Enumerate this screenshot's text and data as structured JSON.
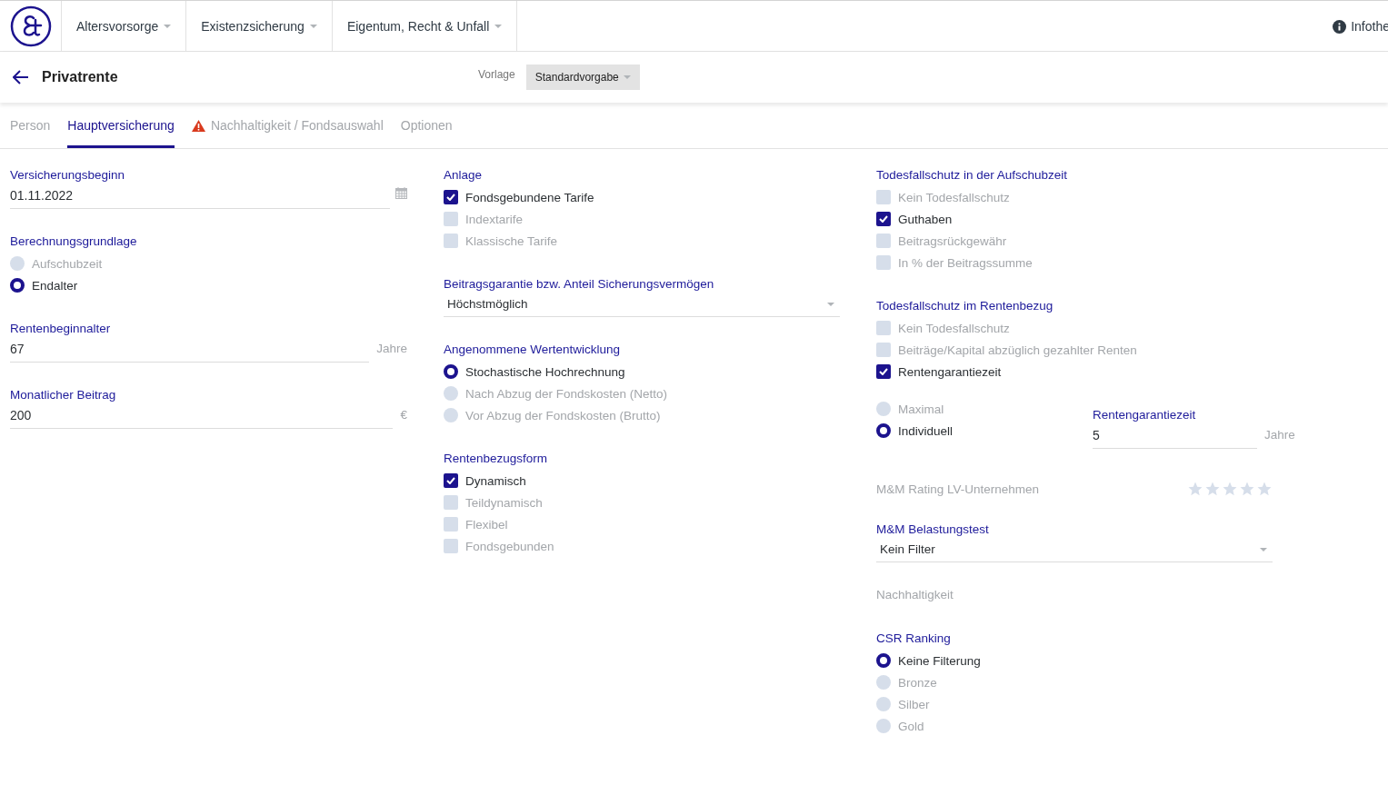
{
  "nav": {
    "items": [
      {
        "label": "Altersvorsorge"
      },
      {
        "label": "Existenzsicherung"
      },
      {
        "label": "Eigentum, Recht & Unfall"
      }
    ],
    "info_link": "Infothe"
  },
  "page_header": {
    "title": "Privatrente",
    "template_label": "Vorlage",
    "template_value": "Standardvorgabe"
  },
  "tabs": [
    {
      "label": "Person",
      "selected": false,
      "warning": false
    },
    {
      "label": "Hauptversicherung",
      "selected": true,
      "warning": false
    },
    {
      "label": "Nachhaltigkeit / Fondsauswahl",
      "selected": false,
      "warning": true
    },
    {
      "label": "Optionen",
      "selected": false,
      "warning": false
    }
  ],
  "columns": [
    {
      "sections": [
        {
          "kind": "date_field",
          "label": "Versicherungsbeginn",
          "value": "01.11.2022"
        },
        {
          "kind": "radio_group",
          "label": "Berechnungsgrundlage",
          "items": [
            {
              "label": "Aufschubzeit",
              "selected": false
            },
            {
              "label": "Endalter",
              "selected": true
            }
          ]
        },
        {
          "kind": "unit_field",
          "label": "Rentenbeginnalter",
          "value": "67",
          "unit": "Jahre"
        },
        {
          "kind": "unit_field",
          "label": "Monatlicher Beitrag",
          "value": "200",
          "unit": "€"
        }
      ]
    },
    {
      "sections": [
        {
          "kind": "checkbox_group",
          "label": "Anlage",
          "items": [
            {
              "label": "Fondsgebundene Tarife",
              "checked": true
            },
            {
              "label": "Indextarife",
              "checked": false
            },
            {
              "label": "Klassische Tarife",
              "checked": false
            }
          ]
        },
        {
          "kind": "select",
          "label": "Beitragsgarantie bzw. Anteil Sicherungsvermögen",
          "value": "Höchstmöglich"
        },
        {
          "kind": "radio_group",
          "label": "Angenommene Wertentwicklung",
          "items": [
            {
              "label": "Stochastische Hochrechnung",
              "selected": true
            },
            {
              "label": "Nach Abzug der Fondskosten (Netto)",
              "selected": false
            },
            {
              "label": "Vor Abzug der Fondskosten (Brutto)",
              "selected": false
            }
          ]
        },
        {
          "kind": "checkbox_group",
          "label": "Rentenbezugsform",
          "items": [
            {
              "label": "Dynamisch",
              "checked": true
            },
            {
              "label": "Teildynamisch",
              "checked": false
            },
            {
              "label": "Flexibel",
              "checked": false
            },
            {
              "label": "Fondsgebunden",
              "checked": false
            }
          ]
        }
      ]
    },
    {
      "sections": [
        {
          "kind": "checkbox_group",
          "label": "Todesfallschutz in der Aufschubzeit",
          "items": [
            {
              "label": "Kein Todesfallschutz",
              "checked": false
            },
            {
              "label": "Guthaben",
              "checked": true
            },
            {
              "label": "Beitragsrückgewähr",
              "checked": false
            },
            {
              "label": "In % der Beitragssumme",
              "checked": false
            }
          ]
        },
        {
          "kind": "checkbox_group",
          "label": "Todesfallschutz im Rentenbezug",
          "items": [
            {
              "label": "Kein Todesfallschutz",
              "checked": false
            },
            {
              "label": "Beiträge/Kapital abzüglich gezahlter Renten",
              "checked": false
            },
            {
              "label": "Rentengarantiezeit",
              "checked": true
            }
          ]
        },
        {
          "kind": "radio_with_field",
          "items": [
            {
              "label": "Maximal",
              "selected": false
            },
            {
              "label": "Individuell",
              "selected": true
            }
          ],
          "field": {
            "label": "Rentengarantiezeit",
            "value": "5",
            "unit": "Jahre"
          }
        },
        {
          "kind": "rating",
          "label": "M&M Rating LV-Unternehmen",
          "stars": 0
        },
        {
          "kind": "select",
          "label": "M&M Belastungstest",
          "value": "Kein Filter"
        },
        {
          "kind": "subheading",
          "label": "Nachhaltigkeit"
        },
        {
          "kind": "radio_group",
          "label": "CSR Ranking",
          "items": [
            {
              "label": "Keine Filterung",
              "selected": true
            },
            {
              "label": "Bronze",
              "selected": false
            },
            {
              "label": "Silber",
              "selected": false
            },
            {
              "label": "Gold",
              "selected": false
            }
          ]
        }
      ]
    }
  ]
}
